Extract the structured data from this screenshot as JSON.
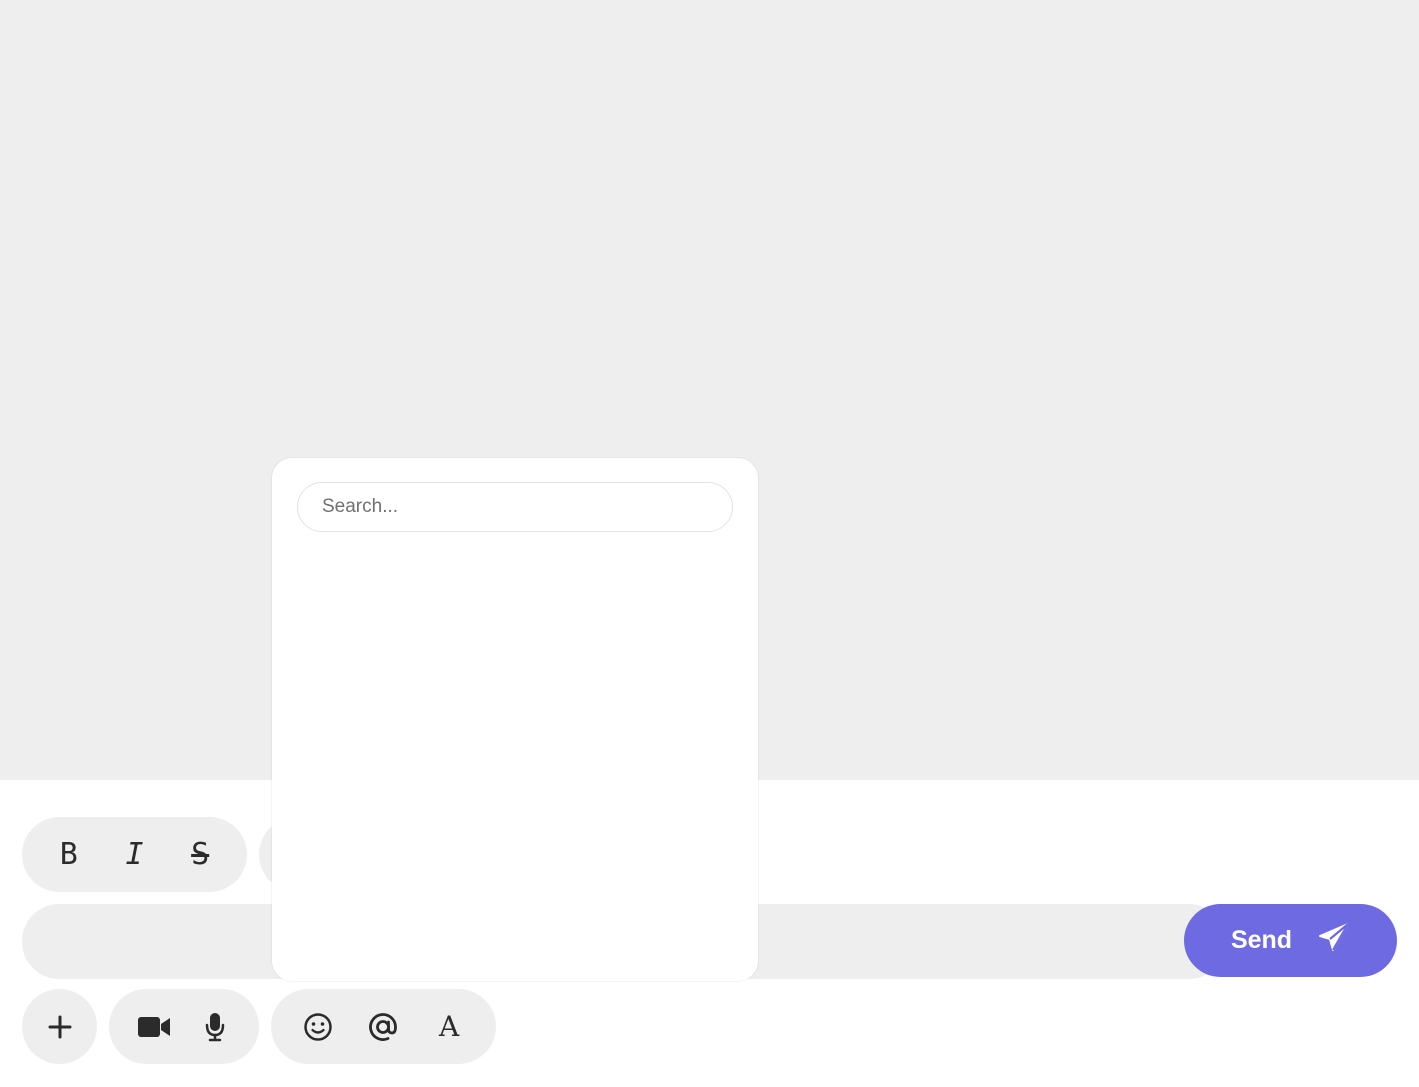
{
  "colors": {
    "chat_background": "#eeeeee",
    "composer_background": "#ffffff",
    "pill_background": "#eeeeee",
    "send_accent": "#6e6be2",
    "icon_color": "#2b2b2b"
  },
  "formatting_toolbar": {
    "items": [
      {
        "name": "bold",
        "glyph": "B",
        "icon": "bold-icon"
      },
      {
        "name": "italic",
        "glyph": "I",
        "icon": "italic-icon"
      },
      {
        "name": "strikethrough",
        "glyph": "S",
        "icon": "strikethrough-icon"
      }
    ]
  },
  "composer": {
    "message_value": "",
    "send_label": "Send",
    "send_icon": "paper-plane-icon"
  },
  "bottom_toolbar": {
    "attach_icon": "plus-icon",
    "media_icons": [
      "video-camera-icon",
      "microphone-icon"
    ],
    "insert_icons": [
      "emoji-icon",
      "at-mention-icon",
      "font-icon"
    ],
    "font_glyph": "A"
  },
  "popup": {
    "search_placeholder": "Search...",
    "search_value": ""
  }
}
